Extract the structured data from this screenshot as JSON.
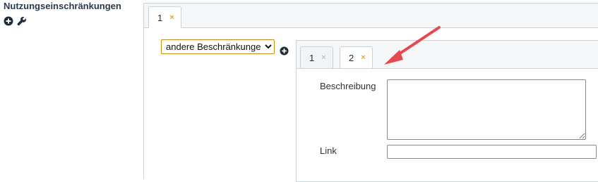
{
  "section": {
    "title": "Nutzungseinschränkungen",
    "add_icon": "plus-circle-icon",
    "edit_icon": "wrench-icon"
  },
  "outer_tabs": [
    {
      "label": "1",
      "close": "×",
      "state": "active"
    }
  ],
  "restriction_type": {
    "selected": "andere Beschränkungen",
    "options": [
      "andere Beschränkungen"
    ]
  },
  "inner_add_icon": "plus-circle-icon",
  "inner_tabs": [
    {
      "label": "1",
      "close": "×",
      "state": "inactive"
    },
    {
      "label": "2",
      "close": "×",
      "state": "active"
    }
  ],
  "form": {
    "description_label": "Beschreibung",
    "description_value": "",
    "link_label": "Link",
    "link_value": ""
  },
  "colors": {
    "title": "#2b3a4a",
    "close_active": "#e3a918",
    "close_inactive": "#b8c4ce",
    "select_border": "#c68c10",
    "annotation_arrow": "#e5484d"
  }
}
